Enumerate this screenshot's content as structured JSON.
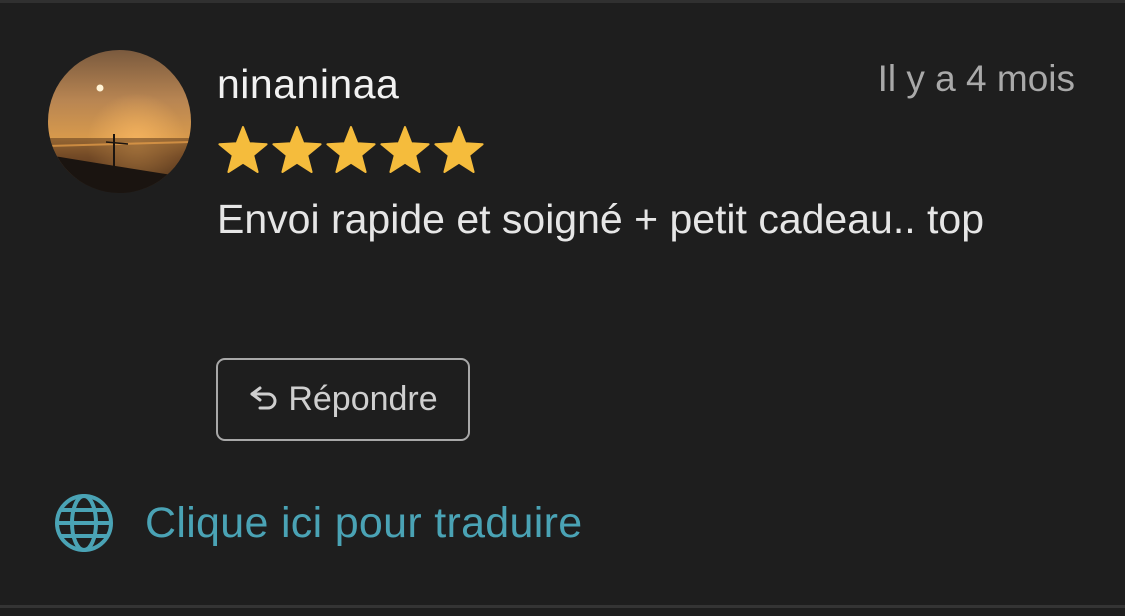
{
  "review": {
    "username": "ninaninaa",
    "timestamp": "Il y a 4 mois",
    "rating": 5,
    "rating_max": 5,
    "text": "Envoi rapide et soigné + petit cadeau.. top"
  },
  "actions": {
    "reply_label": "Répondre",
    "reply_icon": "reply-arrow-icon",
    "translate_label": "Clique ici pour traduire",
    "translate_icon": "globe-icon"
  },
  "colors": {
    "background": "#1e1e1e",
    "star": "#f5bc3c",
    "link": "#4aa3b5",
    "text": "#e6e6e6",
    "muted": "#a9a9a9"
  }
}
